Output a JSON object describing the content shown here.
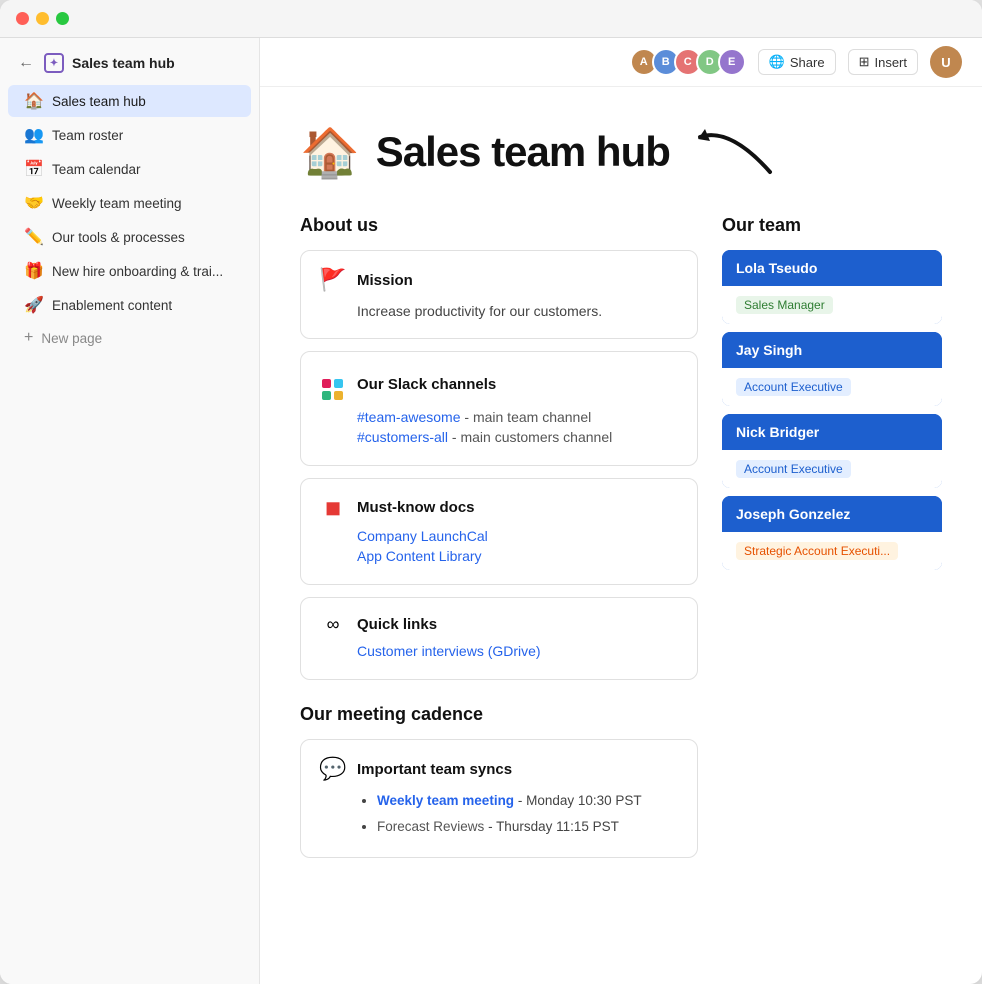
{
  "window": {
    "title": "Sales team hub"
  },
  "sidebar": {
    "workspace_title": "Sales team hub",
    "items": [
      {
        "id": "sales-team-hub",
        "label": "Sales team hub",
        "icon": "🏠",
        "active": true
      },
      {
        "id": "team-roster",
        "label": "Team roster",
        "icon": "👥"
      },
      {
        "id": "team-calendar",
        "label": "Team calendar",
        "icon": "📅"
      },
      {
        "id": "weekly-meeting",
        "label": "Weekly team meeting",
        "icon": "🤝"
      },
      {
        "id": "tools-processes",
        "label": "Our tools & processes",
        "icon": "✏️"
      },
      {
        "id": "new-hire",
        "label": "New hire onboarding & trai...",
        "icon": "🎁"
      },
      {
        "id": "enablement",
        "label": "Enablement content",
        "icon": "🚀"
      }
    ],
    "new_page_label": "New page"
  },
  "topbar": {
    "share_label": "Share",
    "insert_label": "Insert",
    "avatars": [
      {
        "color": "#c0874f",
        "initials": "A"
      },
      {
        "color": "#5b8dd9",
        "initials": "B"
      },
      {
        "color": "#e57373",
        "initials": "C"
      },
      {
        "color": "#81c784",
        "initials": "D"
      },
      {
        "color": "#9575cd",
        "initials": "E"
      }
    ]
  },
  "page": {
    "icon": "🏠",
    "title": "Sales team hub"
  },
  "about_us": {
    "section_title": "About us",
    "cards": [
      {
        "id": "mission",
        "icon": "🚩",
        "title": "Mission",
        "text": "Increase productivity for our customers."
      },
      {
        "id": "slack",
        "icon": "slack",
        "title": "Our Slack channels",
        "links": [
          {
            "text": "#team-awesome",
            "suffix": " - main team channel"
          },
          {
            "text": "#customers-all",
            "suffix": " - main customers channel"
          }
        ]
      },
      {
        "id": "docs",
        "icon": "📄",
        "title": "Must-know docs",
        "links": [
          {
            "text": "Company LaunchCal",
            "suffix": ""
          },
          {
            "text": "App Content Library",
            "suffix": ""
          }
        ]
      },
      {
        "id": "quicklinks",
        "icon": "🔗",
        "title": "Quick links",
        "links": [
          {
            "text": "Customer interviews (GDrive)",
            "suffix": ""
          }
        ]
      }
    ]
  },
  "our_team": {
    "section_title": "Our team",
    "members": [
      {
        "name": "Lola Tseudo",
        "role": "Sales Manager",
        "role_color": "green"
      },
      {
        "name": "Jay Singh",
        "role": "Account Executive",
        "role_color": "blue"
      },
      {
        "name": "Nick Bridger",
        "role": "Account Executive",
        "role_color": "blue"
      },
      {
        "name": "Joseph Gonzelez",
        "role": "Strategic Account Executi...",
        "role_color": "orange"
      }
    ]
  },
  "meeting_cadence": {
    "section_title": "Our meeting cadence",
    "card_icon": "💬",
    "card_title": "Important team syncs",
    "items": [
      {
        "link_text": "Weekly team meeting",
        "suffix": " - Monday 10:30 PST"
      },
      {
        "link_text": "Forecast Reviews",
        "suffix": " - Thursday 11:15 PST"
      }
    ]
  }
}
